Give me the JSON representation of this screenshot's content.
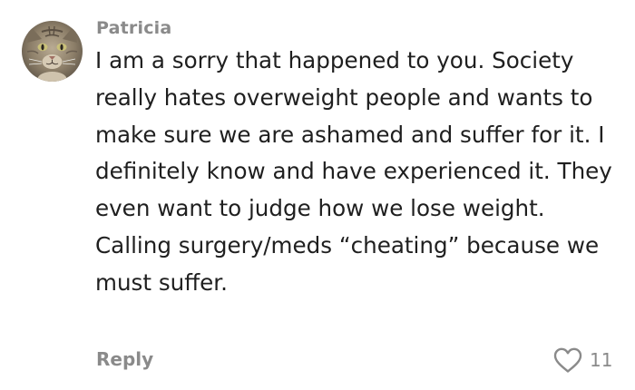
{
  "comment": {
    "author": "Patricia",
    "text": "I am a sorry that happened to you. Society really hates overweight people and wants to make sure we are ashamed and suffer for it. I definitely know and have experienced it. They even want to judge how we lose weight. Calling surgery/meds “cheating” because we must suffer.",
    "reply_label": "Reply",
    "like_count": "11",
    "icons": {
      "avatar": "cat-avatar",
      "like": "heart-outline-icon"
    }
  },
  "colors": {
    "author": "#8a8a8a",
    "text": "#1f1f1f",
    "meta": "#8a8a8a"
  }
}
